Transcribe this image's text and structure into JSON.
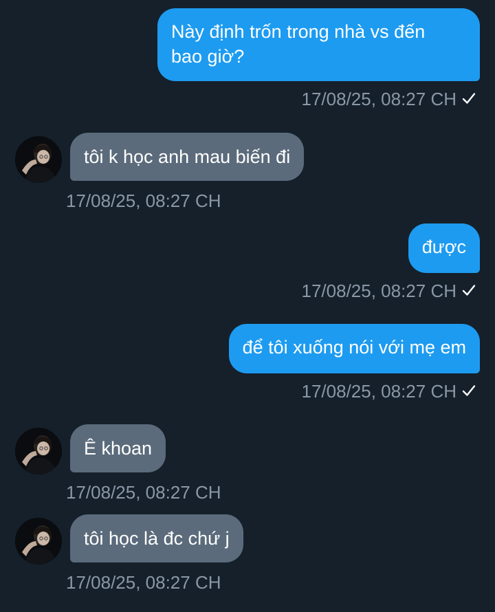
{
  "messages": [
    {
      "direction": "out",
      "text_lines": [
        "Này định trốn trong nhà vs đến",
        "bao giờ?"
      ],
      "timestamp": "17/08/25, 08:27 CH",
      "status_icon": "check-icon"
    },
    {
      "direction": "in",
      "text": "tôi k học anh mau biến đi",
      "timestamp": "17/08/25, 08:27 CH",
      "avatar": "avatar-photo"
    },
    {
      "direction": "out",
      "text": "được",
      "timestamp": "17/08/25, 08:27 CH",
      "status_icon": "check-icon"
    },
    {
      "direction": "out",
      "text": "để tôi xuống nói với mẹ em",
      "timestamp": "17/08/25, 08:27 CH",
      "status_icon": "check-icon"
    },
    {
      "direction": "in",
      "text": "Ê khoan",
      "timestamp": "17/08/25, 08:27 CH",
      "avatar": "avatar-photo"
    },
    {
      "direction": "in",
      "text": "tôi học là đc chứ j",
      "timestamp": "17/08/25, 08:27 CH",
      "avatar": "avatar-photo"
    }
  ],
  "colors": {
    "background": "#15202b",
    "outgoing_bubble": "#1d9bf0",
    "incoming_bubble": "#5b6b7b",
    "timestamp_text": "#8b98a5"
  }
}
